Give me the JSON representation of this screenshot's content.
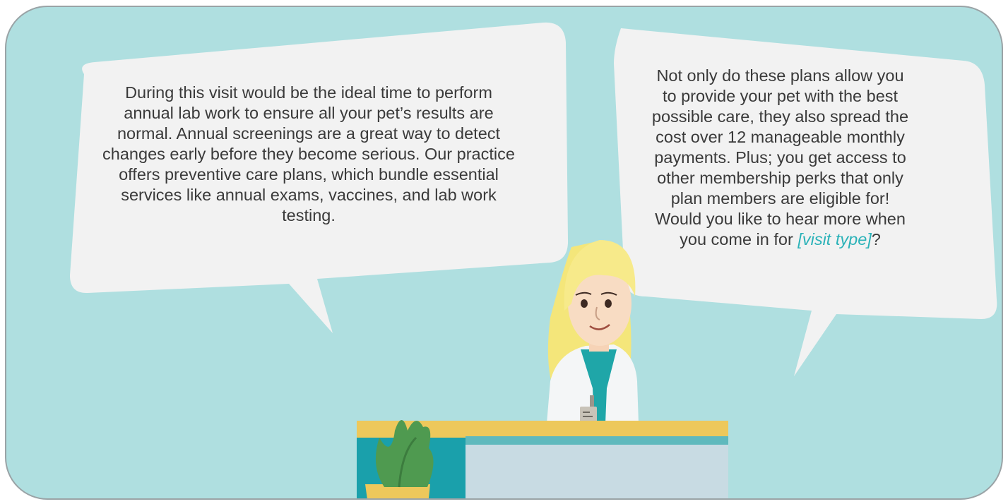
{
  "colors": {
    "background": "#afdfe0",
    "bubble": "#f2f2f2",
    "text": "#3a3a3a",
    "accent": "#2bb2b8"
  },
  "bubbles": {
    "left": {
      "text": "During this visit would be the ideal time to perform annual lab work to ensure all your pet’s results are normal. Annual screenings are a great way to detect changes early before they become serious. Our practice offers preventive care plans, which bundle essential services like annual exams, vaccines, and lab work testing."
    },
    "right": {
      "text_before": "Not only do these plans allow you to provide your pet with the best possible care, they also spread the cost over 12 manageable monthly payments. Plus; you get access to other membership perks that only plan members are eligible for! Would you like to hear more when you come in for ",
      "highlight": "[visit type]",
      "text_after": "?"
    }
  },
  "illustration": {
    "character": "veterinary-receptionist",
    "desk": "reception-desk",
    "plant": "potted-plant"
  }
}
